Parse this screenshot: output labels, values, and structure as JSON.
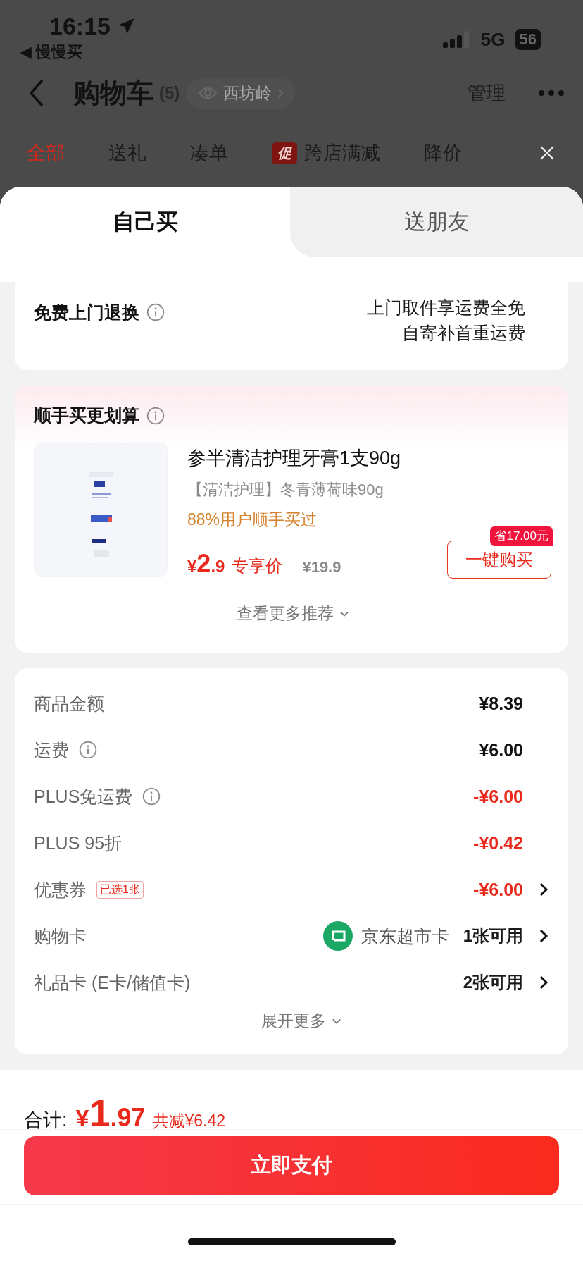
{
  "status_bar": {
    "time": "16:15",
    "back_app": "◀ 慢慢买",
    "network": "5G",
    "battery": "56"
  },
  "nav": {
    "title": "购物车",
    "count": "(5)",
    "location": "西坊岭",
    "manage": "管理"
  },
  "filter_tabs": [
    {
      "label": "全部",
      "selected": true
    },
    {
      "label": "送礼",
      "selected": false
    },
    {
      "label": "凑单",
      "selected": false
    },
    {
      "label": "跨店满减",
      "badge": "促",
      "selected": false
    },
    {
      "label": "降价",
      "selected": false
    }
  ],
  "sheet_tabs": [
    {
      "label": "自己买",
      "selected": true
    },
    {
      "label": "送朋友",
      "selected": false
    }
  ],
  "return_service": {
    "title": "免费上门退换",
    "lines": [
      "上门取件享运费全免",
      "自寄补首重运费"
    ]
  },
  "recommend": {
    "title": "顺手买更划算",
    "product": {
      "name": "参半清洁护理牙膏1支90g",
      "spec": "【清洁护理】冬青薄荷味90g",
      "social_proof": "88%用户顺手买过",
      "price_symbol": "¥",
      "price_int": "2",
      "price_dec": ".9",
      "price_label": "专享价",
      "original_price": "¥19.9",
      "save_badge": "省17.00元",
      "buy_button": "一键购买"
    },
    "more": "查看更多推荐"
  },
  "summary": {
    "rows": [
      {
        "label": "商品金额",
        "kind": "amount",
        "value": "¥8.39",
        "info": false,
        "arrow": false
      },
      {
        "label": "运费",
        "kind": "amount",
        "value": "¥6.00",
        "info": true,
        "arrow": false
      },
      {
        "label": "PLUS免运费",
        "kind": "discount",
        "value": "-¥6.00",
        "info": true,
        "arrow": false
      },
      {
        "label": "PLUS 95折",
        "kind": "discount",
        "value": "-¥0.42",
        "info": false,
        "arrow": false
      },
      {
        "label": "优惠券",
        "kind": "discount",
        "tag": "已选1张",
        "value": "-¥6.00",
        "info": false,
        "arrow": true
      },
      {
        "label": "购物卡",
        "kind": "count",
        "card_name": "京东超市卡",
        "value": "1张可用",
        "info": false,
        "arrow": true
      },
      {
        "label": "礼品卡 (E卡/储值卡)",
        "kind": "count",
        "value": "2张可用",
        "info": false,
        "arrow": true
      }
    ],
    "expand": "展开更多"
  },
  "total": {
    "label": "合计:",
    "symbol": "¥",
    "int": "1",
    "dec": ".97",
    "saved": "共减¥6.42"
  },
  "pay_button": "立即支付"
}
